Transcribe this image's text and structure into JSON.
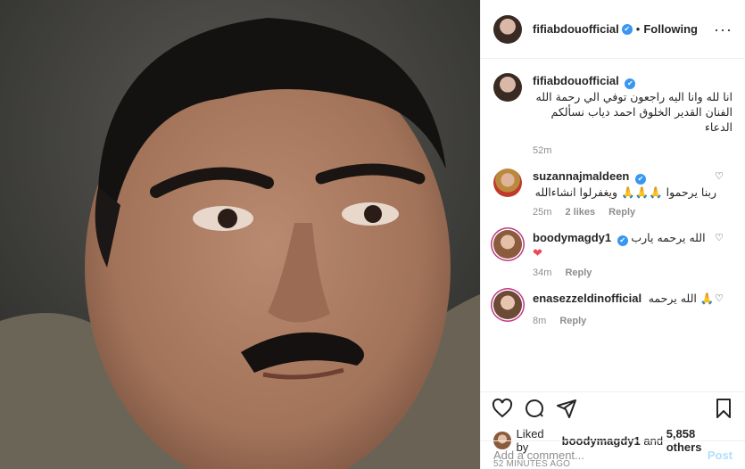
{
  "header": {
    "username": "fifiabdouofficial",
    "verified_badge": "✔",
    "separator": "•",
    "follow_label": "Following",
    "more_label": "···"
  },
  "caption": {
    "username": "fifiabdouofficial",
    "text": "انا لله وانا اليه راجعون توفي الي رحمة الله الفنان القدير الخلوق احمد دياب نسألكم الدعاء",
    "time": "52m"
  },
  "comments": [
    {
      "username": "suzannajmaldeen",
      "verified": true,
      "text": "ربنا يرحموا 🙏🙏🙏 ويغفرلوا انشاءالله",
      "time": "25m",
      "likes": "2 likes",
      "reply": "Reply"
    },
    {
      "username": "boodymagdy1",
      "verified": true,
      "text": "الله يرحمه يارب",
      "emoji": "❤",
      "time": "34m",
      "reply": "Reply"
    },
    {
      "username": "enasezzeldinofficial",
      "verified": false,
      "text": "الله يرحمه 🙏",
      "time": "8m",
      "reply": "Reply"
    }
  ],
  "liked": {
    "prefix": "Liked by",
    "user": "boodymagdy1",
    "and": "and",
    "others": "5,858 others"
  },
  "timestamp": "52 MINUTES AGO",
  "add_comment": {
    "placeholder": "Add a comment...",
    "post_label": "Post"
  },
  "icons": {
    "like": "heart-icon",
    "comment": "comment-icon",
    "share": "share-icon",
    "save": "bookmark-icon"
  },
  "colors": {
    "verified": "#3897f0",
    "post_disabled": "#b2dffc",
    "muted": "#8e8e8e",
    "heart": "#ed4956"
  }
}
